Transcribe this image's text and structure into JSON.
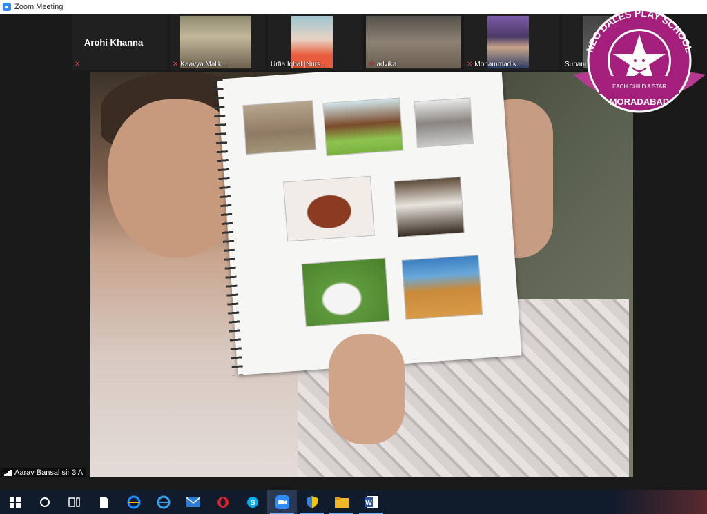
{
  "window": {
    "title": "Zoom Meeting"
  },
  "gallery": {
    "tiles": [
      {
        "name": "Arohi Khanna",
        "muted": true
      },
      {
        "name": "Kaavya Malik ...",
        "muted": true
      },
      {
        "name": "Urfia Iqbal |Nurs...",
        "muted": false
      },
      {
        "name": "advika",
        "muted": true
      },
      {
        "name": "Mohammad k...",
        "muted": true
      },
      {
        "name": "Suhani",
        "muted": false
      }
    ]
  },
  "active_speaker": {
    "name": "Aarav  Bansal sir 3 A"
  },
  "watermark": {
    "arc_text": "NEO DALES PLAY SCHOOL",
    "tagline": "EACH CHILD A STAR",
    "city": "MORADABAD",
    "colors": {
      "primary": "#a4207c",
      "ribbon": "#b63a8f"
    }
  },
  "taskbar": {
    "icons": [
      "windows-start-icon",
      "search-circle-icon",
      "task-view-icon",
      "file-icon",
      "edge-icon",
      "ie-icon",
      "mail-icon",
      "opera-icon",
      "skype-icon",
      "zoom-icon",
      "shield-icon",
      "file-explorer-icon",
      "word-icon"
    ]
  }
}
